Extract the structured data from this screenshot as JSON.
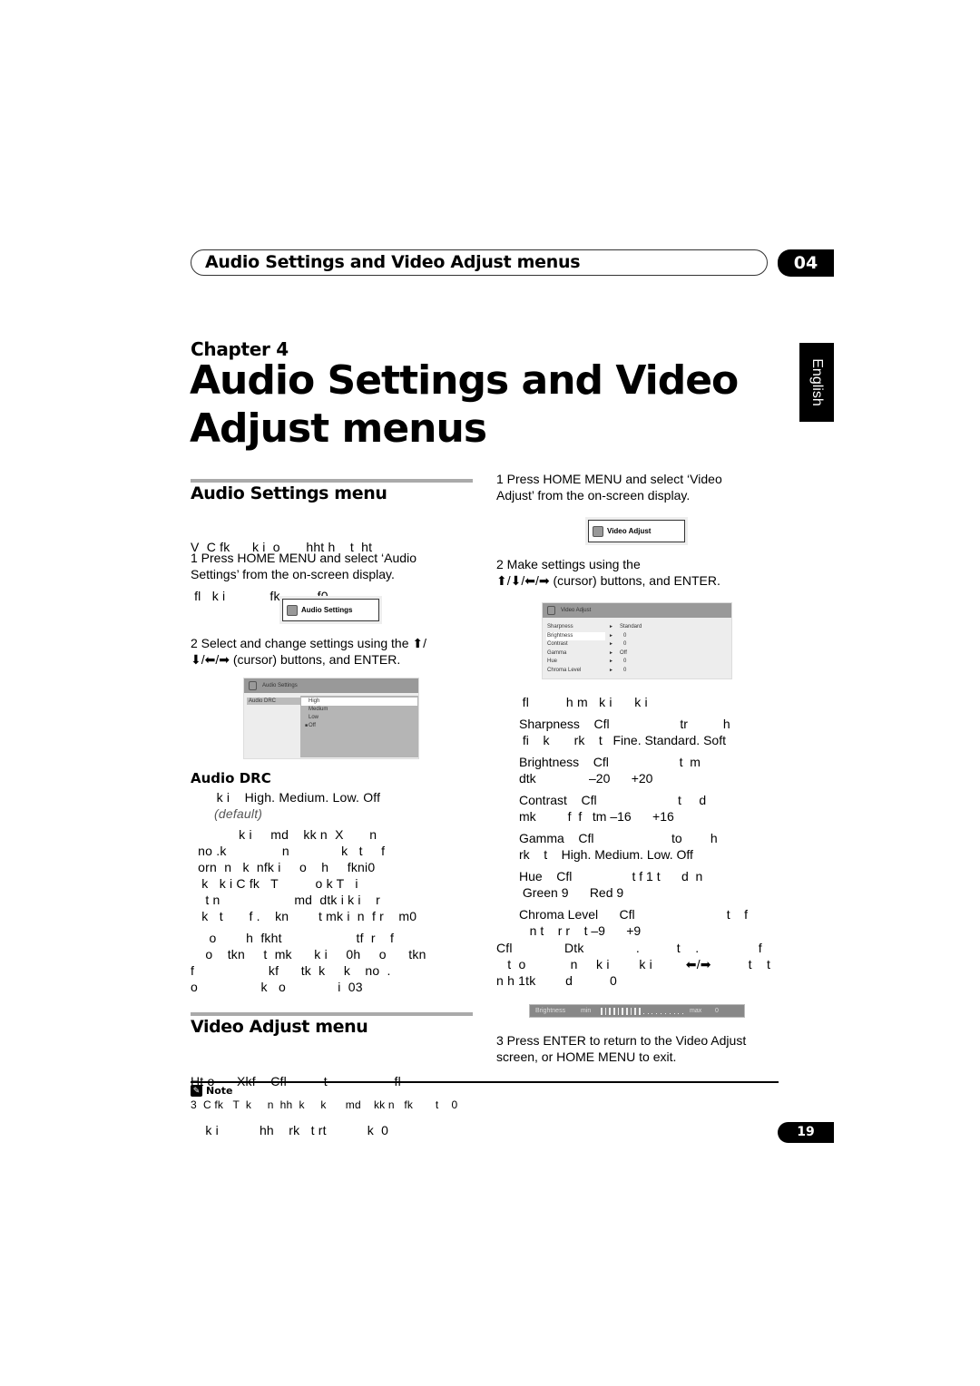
{
  "header": {
    "title": "Audio Settings and Video Adjust menus",
    "chapter_number": "04"
  },
  "chapter": {
    "label": "Chapter 4",
    "title_line1": "Audio Settings and Video",
    "title_line2": "Adjust menus"
  },
  "language_tab": "English",
  "audio_section": {
    "title": "Audio Settings menu",
    "intro_line1": "V  C fk      k i  o       hht h    t  ht",
    "intro_line2": " fl   k i            fk          f0",
    "step1_line1": "1   Press HOME MENU and select ‘Audio",
    "step1_line2": "Settings’ from the on-screen display.",
    "menu_button": "Audio Settings",
    "step2_line1": "2   Select and change settings using the ⬆/",
    "step2_line2": "⬇/⬅/➡ (cursor) buttons, and ENTER.",
    "osd": {
      "title": "Audio Settings",
      "item": "Audio DRC",
      "options": [
        "High",
        "Medium",
        "Low",
        "Off"
      ],
      "highlighted": "High",
      "selected": "Off"
    },
    "drc": {
      "title": "Audio DRC",
      "settings_line": "       k i    High. Medium. Low. Off",
      "default_label": "(default)",
      "para1": [
        "             k i     md    kk n  X       n",
        "  no .k               n              k   t     f",
        "  orn  n   k  nfk i     o    h     fkni0",
        "   k   k i C fk   T          o k T   i",
        "    t n                    md  dtk i k i    r",
        "   k   t       f .    kn        t mk i  n  f r    m0"
      ],
      "para2": [
        "     o        h  fkht                    tf  r    f",
        "    o    tkn     t  mk      k i     0h     o      tkn",
        "f                    kf      tk  k     k    no  .",
        "o                 k   o              i  03"
      ]
    }
  },
  "video_section": {
    "title": "Video Adjust menu",
    "intro_line1": "Ht o      Xkf    Cfl          t                  fl",
    "intro_line2": "    k i           hh    rk   t rt           k  0",
    "step1_line1": "1   Press HOME MENU and select ‘Video",
    "step1_line2": "Adjust’ from the on-screen display.",
    "menu_button": "Video Adjust",
    "step2_line1": "2   Make settings using the",
    "step2_line2": "⬆/⬇/⬅/➡ (cursor) buttons, and ENTER.",
    "osd": {
      "title": "Video Adjust",
      "rows": [
        {
          "label": "Sharpness",
          "value": "Standard"
        },
        {
          "label": "Brightness",
          "value": "0"
        },
        {
          "label": "Contrast",
          "value": "0"
        },
        {
          "label": "Gamma",
          "value": "Off"
        },
        {
          "label": "Hue",
          "value": "0"
        },
        {
          "label": "Chroma Level",
          "value": "0"
        }
      ],
      "highlighted": "Brightness",
      "arrow": "►"
    },
    "list_intro": "       fl          h m   k i      k i",
    "items": [
      {
        "line1": "Sharpness    Cfl                    tr          h",
        "line2": " fi    k       rk    t   Fine. Standard. Soft"
      },
      {
        "line1": "Brightness    Cfl                    t  m",
        "line2": "dtk               –20      +20"
      },
      {
        "line1": "Contrast    Cfl                       t     d",
        "line2": "mk         f  f   tm –16      +16"
      },
      {
        "line1": "Gamma    Cfl                      to        h",
        "line2": "rk    t    High. Medium. Low. Off"
      },
      {
        "line1": "Hue    Cfl                 t f 1 t      d  n",
        "line2": " Green 9      Red 9"
      },
      {
        "line1": "Chroma Level      Cfl                          t    f",
        "line2": "   n t    r r    t –9      +9"
      }
    ],
    "adjust_para": [
      "Cfl              Dtk              .          t    .                f",
      "   t  o            n     k i        k i         ⬅/➡          t    t",
      "n h 1tk        d          0"
    ],
    "bright_bar": {
      "label": "Brightness",
      "min_label": "min",
      "max_label": "max",
      "value": "0",
      "level_fraction": 0.5,
      "segments": 20
    },
    "step3_line1": "3   Press ENTER to return to the Video Adjust",
    "step3_line2": "screen, or HOME MENU to exit."
  },
  "note": {
    "label": "Note",
    "text": "3  C fk   T  k     n  hh  k     k      md    kk n   fk       t    0"
  },
  "page_number": "19"
}
